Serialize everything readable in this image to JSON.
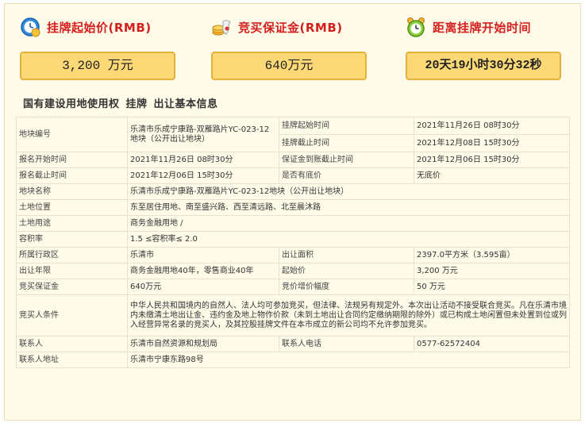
{
  "cards": [
    {
      "label": "挂牌起始价(RMB)",
      "value": "3,200 万元",
      "icon": "clock-money-icon"
    },
    {
      "label": "竞买保证金(RMB)",
      "value": "640万元",
      "icon": "coins-bag-icon"
    },
    {
      "label": "距离挂牌开始时间",
      "value": "20天19小时30分32秒",
      "icon": "alarm-clock-icon"
    }
  ],
  "section_title": {
    "part1": "国有建设用地使用权",
    "part2": "挂牌",
    "part3": "出让基本信息"
  },
  "table": {
    "plot_no_label": "地块编号",
    "plot_no_value": "乐清市乐成宁康路-双雁路片YC-023-12地块（公开出让地块）",
    "listing_start_label": "挂牌起始时间",
    "listing_start_value": "2021年11月26日 08时30分",
    "listing_end_label": "挂牌截止时间",
    "listing_end_value": "2021年12月08日 15时30分",
    "reg_start_label": "报名开始时间",
    "reg_start_value": "2021年11月26日 08时30分",
    "deposit_deadline_label": "保证金到账截止时间",
    "deposit_deadline_value": "2021年12月06日 15时30分",
    "reg_end_label": "报名截止时间",
    "reg_end_value": "2021年12月06日 15时30分",
    "reserve_label": "是否有底价",
    "reserve_value": "无底价",
    "plot_name_label": "地块名称",
    "plot_name_value": "乐清市乐成宁康路-双雁路片YC-023-12地块（公开出让地块）",
    "location_label": "土地位置",
    "location_value": "东至居住用地、南至盛兴路、西至清远路、北至晨沐路",
    "use_label": "土地用途",
    "use_value": "商务金融用地 /",
    "far_label": "容积率",
    "far_value": "1.5 ≤容积率≤ 2.0",
    "district_label": "所属行政区",
    "district_value": "乐清市",
    "area_label": "出让面积",
    "area_value": "2397.0平方米（3.595亩）",
    "term_label": "出让年限",
    "term_value": "商务金融用地40年，零售商业40年",
    "start_price_label": "起始价",
    "start_price_value": "3,200 万元",
    "deposit_label": "竞买保证金",
    "deposit_value": "640万元",
    "increment_label": "竞价增价幅度",
    "increment_value": "50 万元",
    "bidder_label": "竞买人条件",
    "bidder_value": "中华人民共和国境内的自然人、法人均可参加竞买，但法律、法规另有规定外。本次出让活动不接受联合竞买。凡在乐清市境内未缴清土地出让金、违约金及地上物作价款（未到土地出让合同约定缴纳期限的除外）或已构成土地闲置但未处置到位或列入经营异常名录的竞买人，及其控股挂牌文件在本市成立的新公司均不允许参加竞买。",
    "contact_label": "联系人",
    "contact_value": "乐清市自然资源和规划局",
    "phone_label": "联系人电话",
    "phone_value": "0577-62572404",
    "address_label": "联系人地址",
    "address_value": "乐清市宁康东路98号"
  }
}
